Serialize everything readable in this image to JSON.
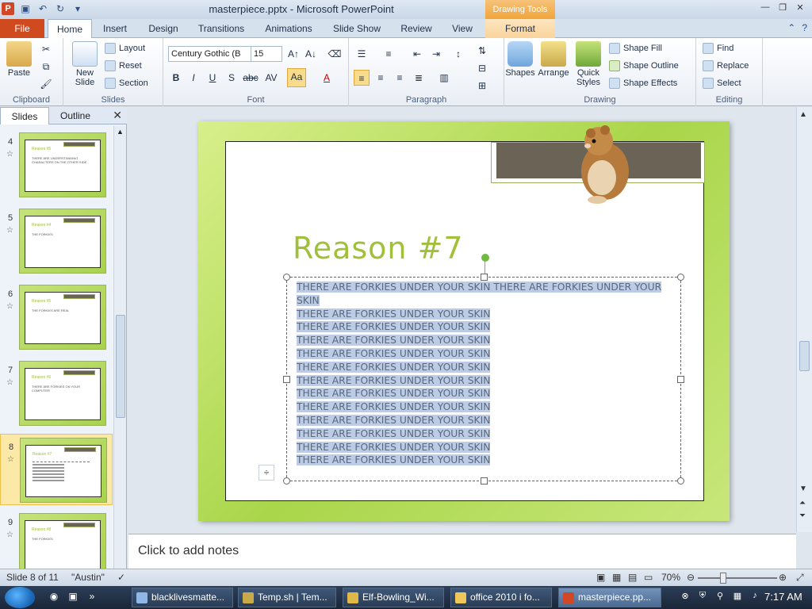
{
  "titlebar": {
    "title": "masterpiece.pptx - Microsoft PowerPoint",
    "context_tab": "Drawing Tools"
  },
  "tabs": [
    "File",
    "Home",
    "Insert",
    "Design",
    "Transitions",
    "Animations",
    "Slide Show",
    "Review",
    "View",
    "Format"
  ],
  "ribbon": {
    "clipboard": {
      "paste": "Paste",
      "label": "Clipboard"
    },
    "slides": {
      "new_slide": "New Slide",
      "layout": "Layout",
      "reset": "Reset",
      "section": "Section",
      "label": "Slides"
    },
    "font": {
      "font_name": "Century Gothic (B",
      "font_size": "15",
      "label": "Font"
    },
    "paragraph": {
      "label": "Paragraph"
    },
    "drawing": {
      "shapes": "Shapes",
      "arrange": "Arrange",
      "quick_styles": "Quick Styles",
      "shape_fill": "Shape Fill",
      "shape_outline": "Shape Outline",
      "shape_effects": "Shape Effects",
      "label": "Drawing"
    },
    "editing": {
      "find": "Find",
      "replace": "Replace",
      "select": "Select",
      "label": "Editing"
    }
  },
  "left_panel": {
    "tabs": [
      "Slides",
      "Outline"
    ],
    "thumbs": [
      {
        "num": "4",
        "title": "Reason #5",
        "body": "THERE ARE UNDERSTANDING CHARACTERS ON THE OTHER SIDE"
      },
      {
        "num": "5",
        "title": "Reason #4",
        "body": "THE FORKIES"
      },
      {
        "num": "6",
        "title": "Reason #5",
        "body": "THE FORKIES ARE REAL"
      },
      {
        "num": "7",
        "title": "Reason #6",
        "body": "THERE ARE FORKIES ON YOUR COMPUTER"
      },
      {
        "num": "8",
        "title": "Reason #7",
        "body": ""
      },
      {
        "num": "9",
        "title": "Reason #8",
        "body": "THE FORKIES"
      }
    ]
  },
  "slide": {
    "title": "Reason #7",
    "lines": [
      "THERE ARE FORKIES UNDER YOUR SKIN THERE ARE FORKIES UNDER YOUR",
      "SKIN",
      "THERE ARE FORKIES UNDER YOUR SKIN",
      "THERE ARE FORKIES UNDER YOUR SKIN",
      "THERE ARE FORKIES UNDER YOUR SKIN",
      "THERE ARE FORKIES UNDER YOUR SKIN",
      "THERE ARE FORKIES UNDER YOUR SKIN",
      "THERE ARE FORKIES UNDER YOUR SKIN",
      "THERE ARE FORKIES UNDER YOUR SKIN",
      "THERE ARE FORKIES UNDER YOUR SKIN",
      "THERE ARE FORKIES UNDER YOUR SKIN",
      "THERE ARE FORKIES UNDER YOUR SKIN",
      "THERE ARE FORKIES UNDER YOUR SKIN",
      "THERE ARE FORKIES UNDER YOUR SKIN"
    ]
  },
  "notes": {
    "placeholder": "Click to add notes"
  },
  "status": {
    "slide_info": "Slide 8 of 11",
    "theme": "\"Austin\"",
    "zoom": "70%"
  },
  "taskbar": {
    "tasks": [
      "blacklivesmatte...",
      "Temp.sh | Tem...",
      "Elf-Bowling_Wi...",
      "office 2010 i fo...",
      "masterpiece.pp..."
    ],
    "clock": "7:17 AM"
  },
  "colors": {
    "accent_file": "#d04a1f",
    "slide_title": "#a1c03a",
    "slide_green": "#a9d64a",
    "selection": "#bccbe6"
  }
}
